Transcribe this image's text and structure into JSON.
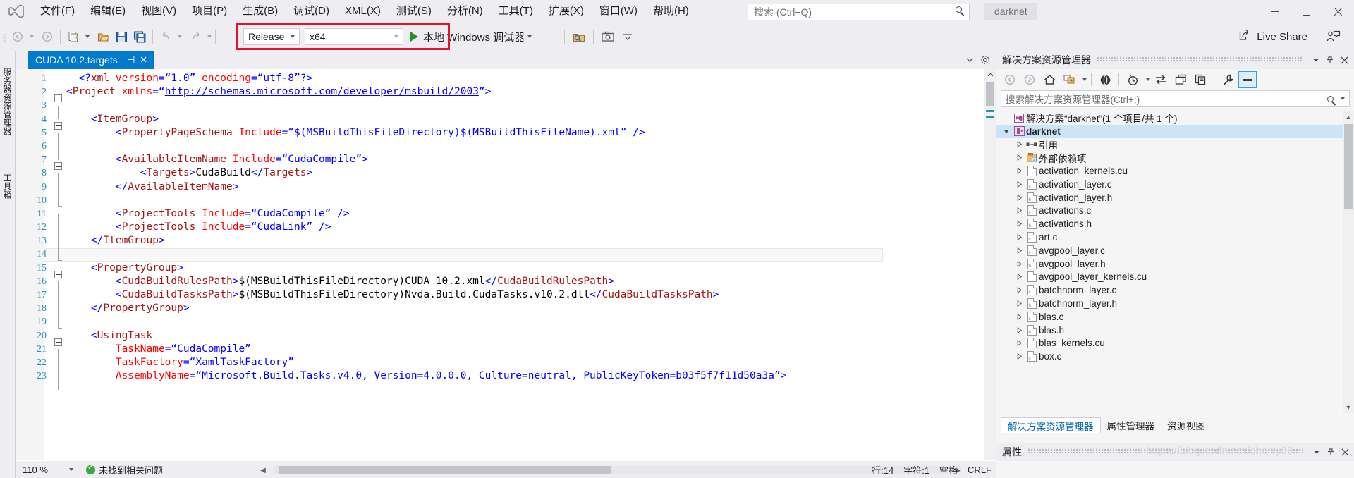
{
  "titlebar": {
    "logo_icon": "visual-studio-logo",
    "menus": [
      {
        "label": "文件(F)",
        "mnemonic": "F"
      },
      {
        "label": "编辑(E)",
        "mnemonic": "E"
      },
      {
        "label": "视图(V)",
        "mnemonic": "V"
      },
      {
        "label": "项目(P)",
        "mnemonic": "P"
      },
      {
        "label": "生成(B)",
        "mnemonic": "B"
      },
      {
        "label": "调试(D)",
        "mnemonic": "D"
      },
      {
        "label": "XML(X)",
        "mnemonic": "X"
      },
      {
        "label": "测试(S)",
        "mnemonic": "S"
      },
      {
        "label": "分析(N)",
        "mnemonic": "N"
      },
      {
        "label": "工具(T)",
        "mnemonic": "T"
      },
      {
        "label": "扩展(X)",
        "mnemonic": "X"
      },
      {
        "label": "窗口(W)",
        "mnemonic": "W"
      },
      {
        "label": "帮助(H)",
        "mnemonic": "H"
      }
    ],
    "search_placeholder": "搜索 (Ctrl+Q)",
    "search_value": "",
    "project_name": "darknet",
    "window_minimize": "—",
    "window_maximize": "□",
    "window_close": "✕"
  },
  "toolbar": {
    "config_value": "Release",
    "platform_value": "x64",
    "run_label": "本地 Windows 调试器",
    "live_share_label": "Live Share",
    "highlight_color": "#E8112D"
  },
  "left_rail": {
    "tabs": [
      "服务器资源管理器",
      "工具箱"
    ]
  },
  "editor": {
    "tab_title": "CUDA 10.2.targets",
    "pin_glyph": "⊣",
    "close_glyph": "✕",
    "zoom_level": "110 %",
    "error_summary": "未找到相关问题",
    "caret_line": "行:14",
    "caret_col": "字符:1",
    "spaces": "空格",
    "encoding": "CRLF",
    "lines": [
      {
        "n": "1",
        "fold": "none",
        "indent": 2,
        "tokens": [
          [
            "br",
            "<?"
          ],
          [
            "el",
            "xml"
          ],
          [
            "tx",
            " "
          ],
          [
            "at",
            "version"
          ],
          [
            "br",
            "="
          ],
          [
            "va",
            "“1.0”"
          ],
          [
            "tx",
            " "
          ],
          [
            "at",
            "encoding"
          ],
          [
            "br",
            "="
          ],
          [
            "va",
            "“utf-8”"
          ],
          [
            "br",
            "?>"
          ]
        ]
      },
      {
        "n": "2",
        "fold": "minus",
        "indent": 0,
        "tokens": [
          [
            "br",
            "<"
          ],
          [
            "el",
            "Project"
          ],
          [
            "tx",
            " "
          ],
          [
            "at",
            "xmlns"
          ],
          [
            "br",
            "="
          ],
          [
            "va",
            "“"
          ],
          [
            "ln",
            "http://schemas.microsoft.com/developer/msbuild/2003"
          ],
          [
            "va",
            "”"
          ],
          [
            "br",
            ">"
          ]
        ]
      },
      {
        "n": "3",
        "fold": "line",
        "indent": 0,
        "tokens": []
      },
      {
        "n": "4",
        "fold": "minus",
        "indent": 4,
        "tokens": [
          [
            "br",
            "<"
          ],
          [
            "el",
            "ItemGroup"
          ],
          [
            "br",
            ">"
          ]
        ]
      },
      {
        "n": "5",
        "fold": "line",
        "indent": 8,
        "tokens": [
          [
            "br",
            "<"
          ],
          [
            "el",
            "PropertyPageSchema"
          ],
          [
            "tx",
            " "
          ],
          [
            "at",
            "Include"
          ],
          [
            "br",
            "="
          ],
          [
            "va",
            "“$(MSBuildThisFileDirectory)$(MSBuildThisFileName).xml”"
          ],
          [
            "tx",
            " "
          ],
          [
            "br",
            "/>"
          ]
        ]
      },
      {
        "n": "6",
        "fold": "line",
        "indent": 0,
        "tokens": []
      },
      {
        "n": "7",
        "fold": "minus",
        "indent": 8,
        "tokens": [
          [
            "br",
            "<"
          ],
          [
            "el",
            "AvailableItemName"
          ],
          [
            "tx",
            " "
          ],
          [
            "at",
            "Include"
          ],
          [
            "br",
            "="
          ],
          [
            "va",
            "“CudaCompile”"
          ],
          [
            "br",
            ">"
          ]
        ]
      },
      {
        "n": "8",
        "fold": "line",
        "indent": 12,
        "tokens": [
          [
            "br",
            "<"
          ],
          [
            "el",
            "Targets"
          ],
          [
            "br",
            ">"
          ],
          [
            "tx",
            "CudaBuild"
          ],
          [
            "br",
            "</"
          ],
          [
            "el",
            "Targets"
          ],
          [
            "br",
            ">"
          ]
        ]
      },
      {
        "n": "9",
        "fold": "line",
        "indent": 8,
        "tokens": [
          [
            "br",
            "</"
          ],
          [
            "el",
            "AvailableItemName"
          ],
          [
            "br",
            ">"
          ]
        ]
      },
      {
        "n": "10",
        "fold": "end",
        "indent": 0,
        "tokens": []
      },
      {
        "n": "11",
        "fold": "line",
        "indent": 8,
        "tokens": [
          [
            "br",
            "<"
          ],
          [
            "el",
            "ProjectTools"
          ],
          [
            "tx",
            " "
          ],
          [
            "at",
            "Include"
          ],
          [
            "br",
            "="
          ],
          [
            "va",
            "“CudaCompile”"
          ],
          [
            "tx",
            " "
          ],
          [
            "br",
            "/>"
          ]
        ]
      },
      {
        "n": "12",
        "fold": "line",
        "indent": 8,
        "tokens": [
          [
            "br",
            "<"
          ],
          [
            "el",
            "ProjectTools"
          ],
          [
            "tx",
            " "
          ],
          [
            "at",
            "Include"
          ],
          [
            "br",
            "="
          ],
          [
            "va",
            "“CudaLink”"
          ],
          [
            "tx",
            " "
          ],
          [
            "br",
            "/>"
          ]
        ]
      },
      {
        "n": "13",
        "fold": "line",
        "indent": 4,
        "tokens": [
          [
            "br",
            "</"
          ],
          [
            "el",
            "ItemGroup"
          ],
          [
            "br",
            ">"
          ]
        ]
      },
      {
        "n": "14",
        "fold": "end",
        "indent": 0,
        "tokens": []
      },
      {
        "n": "15",
        "fold": "minus",
        "indent": 4,
        "tokens": [
          [
            "br",
            "<"
          ],
          [
            "el",
            "PropertyGroup"
          ],
          [
            "br",
            ">"
          ]
        ]
      },
      {
        "n": "16",
        "fold": "line",
        "indent": 8,
        "tokens": [
          [
            "br",
            "<"
          ],
          [
            "el",
            "CudaBuildRulesPath"
          ],
          [
            "br",
            ">"
          ],
          [
            "tx",
            "$(MSBuildThisFileDirectory)CUDA 10.2.xml"
          ],
          [
            "br",
            "</"
          ],
          [
            "el",
            "CudaBuildRulesPath"
          ],
          [
            "br",
            ">"
          ]
        ]
      },
      {
        "n": "17",
        "fold": "line",
        "indent": 8,
        "tokens": [
          [
            "br",
            "<"
          ],
          [
            "el",
            "CudaBuildTasksPath"
          ],
          [
            "br",
            ">"
          ],
          [
            "tx",
            "$(MSBuildThisFileDirectory)Nvda.Build.CudaTasks.v10.2.dll"
          ],
          [
            "br",
            "</"
          ],
          [
            "el",
            "CudaBuildTasksPath"
          ],
          [
            "br",
            ">"
          ]
        ]
      },
      {
        "n": "18",
        "fold": "line",
        "indent": 4,
        "tokens": [
          [
            "br",
            "</"
          ],
          [
            "el",
            "PropertyGroup"
          ],
          [
            "br",
            ">"
          ]
        ]
      },
      {
        "n": "19",
        "fold": "end",
        "indent": 0,
        "tokens": []
      },
      {
        "n": "20",
        "fold": "minus",
        "indent": 4,
        "tokens": [
          [
            "br",
            "<"
          ],
          [
            "el",
            "UsingTask"
          ]
        ]
      },
      {
        "n": "21",
        "fold": "line",
        "indent": 8,
        "tokens": [
          [
            "at",
            "TaskName"
          ],
          [
            "br",
            "="
          ],
          [
            "va",
            "“CudaCompile”"
          ]
        ]
      },
      {
        "n": "22",
        "fold": "line",
        "indent": 8,
        "tokens": [
          [
            "at",
            "TaskFactory"
          ],
          [
            "br",
            "="
          ],
          [
            "va",
            "“XamlTaskFactory”"
          ]
        ]
      },
      {
        "n": "23",
        "fold": "line",
        "indent": 8,
        "tokens": [
          [
            "at",
            "AssemblyName"
          ],
          [
            "br",
            "="
          ],
          [
            "va",
            "“Microsoft.Build.Tasks.v4.0, Version=4.0.0.0, Culture=neutral, PublicKeyToken=b03f5f7f11d50a3a”"
          ],
          [
            "br",
            ">"
          ]
        ]
      }
    ]
  },
  "solution_explorer": {
    "panel_title": "解决方案资源管理器",
    "search_placeholder": "搜索解决方案资源管理器(Ctrl+;)",
    "search_value": "",
    "toolbar_icons": [
      "back-icon",
      "forward-icon",
      "home-icon",
      "collapse-all-icon",
      "chevron-down-icon",
      "show-all-files-icon",
      "pending-changes-icon",
      "chevron-down-icon",
      "sync-with-active-document-icon",
      "new-folder-icon",
      "copy-icon",
      "properties-wrench-icon",
      "preview-selected-items-icon"
    ],
    "solution_row": "解决方案“darknet”(1 个项目/共 1 个)",
    "tree": [
      {
        "label": "darknet",
        "depth": 1,
        "icon": "cpp-project-icon",
        "selected": true,
        "expander": "expanded"
      },
      {
        "label": "引用",
        "depth": 2,
        "icon": "references-icon",
        "expander": "collapsed"
      },
      {
        "label": "外部依赖项",
        "depth": 2,
        "icon": "external-deps-icon",
        "expander": "collapsed"
      },
      {
        "label": "activation_kernels.cu",
        "depth": 2,
        "icon": "file-icon",
        "ext": "",
        "expander": "collapsed"
      },
      {
        "label": "activation_layer.c",
        "depth": 2,
        "icon": "file-icon",
        "ext": "c",
        "expander": "collapsed"
      },
      {
        "label": "activation_layer.h",
        "depth": 2,
        "icon": "file-icon",
        "ext": "h",
        "expander": "collapsed"
      },
      {
        "label": "activations.c",
        "depth": 2,
        "icon": "file-icon",
        "ext": "c",
        "expander": "collapsed"
      },
      {
        "label": "activations.h",
        "depth": 2,
        "icon": "file-icon",
        "ext": "h",
        "expander": "collapsed"
      },
      {
        "label": "art.c",
        "depth": 2,
        "icon": "file-icon",
        "ext": "c",
        "expander": "collapsed"
      },
      {
        "label": "avgpool_layer.c",
        "depth": 2,
        "icon": "file-icon",
        "ext": "c",
        "expander": "collapsed"
      },
      {
        "label": "avgpool_layer.h",
        "depth": 2,
        "icon": "file-icon",
        "ext": "h",
        "expander": "collapsed"
      },
      {
        "label": "avgpool_layer_kernels.cu",
        "depth": 2,
        "icon": "file-icon",
        "ext": "",
        "expander": "collapsed"
      },
      {
        "label": "batchnorm_layer.c",
        "depth": 2,
        "icon": "file-icon",
        "ext": "c",
        "expander": "collapsed"
      },
      {
        "label": "batchnorm_layer.h",
        "depth": 2,
        "icon": "file-icon",
        "ext": "h",
        "expander": "collapsed"
      },
      {
        "label": "blas.c",
        "depth": 2,
        "icon": "file-icon",
        "ext": "c",
        "expander": "collapsed"
      },
      {
        "label": "blas.h",
        "depth": 2,
        "icon": "file-icon",
        "ext": "h",
        "expander": "collapsed"
      },
      {
        "label": "blas_kernels.cu",
        "depth": 2,
        "icon": "file-icon",
        "ext": "",
        "expander": "collapsed"
      },
      {
        "label": "box.c",
        "depth": 2,
        "icon": "file-icon",
        "ext": "c",
        "expander": "collapsed"
      }
    ],
    "bottom_tabs": [
      {
        "label": "解决方案资源管理器",
        "active": true
      },
      {
        "label": "属性管理器",
        "active": false
      },
      {
        "label": "资源视图",
        "active": false
      }
    ],
    "properties_title": "属性"
  },
  "watermark": "https://blog.csdn.net/cherry98"
}
